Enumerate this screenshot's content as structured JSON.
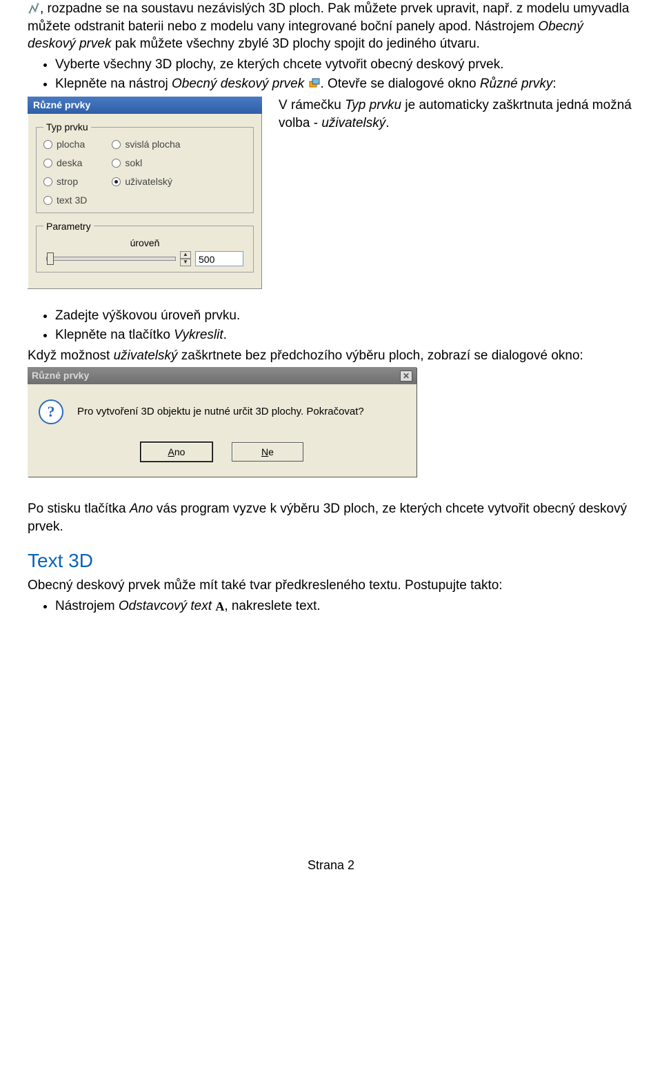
{
  "intro": {
    "p1_prefix": ", rozpadne se na soustavu nezávislých 3D ploch. Pak můžete prvek upravit, např. z modelu umyvadla můžete odstranit baterii nebo z modelu vany integrované boční panely apod. Nástrojem ",
    "p1_italic1": "Obecný deskový prvek",
    "p1_suffix": " pak můžete všechny zbylé 3D plochy spojit do jediného útvaru."
  },
  "bullets1": {
    "b1": "Vyberte všechny 3D plochy, ze kterých chcete vytvořit obecný deskový prvek.",
    "b2_pre": "Klepněte na nástroj ",
    "b2_it": "Obecný deskový prvek",
    "b2_mid": ". Otevře se dialogové okno ",
    "b2_it2": "Různé prvky",
    "b2_end": ":"
  },
  "panel1": {
    "title": "Různé prvky",
    "legend_typ": "Typ prvku",
    "radios": {
      "plocha": "plocha",
      "deska": "deska",
      "strop": "strop",
      "text3d": "text 3D",
      "svisla": "svislá plocha",
      "sokl": "sokl",
      "uzivatelsky": "uživatelský"
    },
    "legend_param": "Parametry",
    "param_label": "úroveň",
    "value": "500"
  },
  "side_note": {
    "pre": "V rámečku ",
    "it1": "Typ prvku",
    "mid": " je automaticky zaškrtnuta jedná možná volba - ",
    "it2": "uživatelský",
    "end": "."
  },
  "bullets2": {
    "b1": "Zadejte výškovou úroveň prvku.",
    "b2_pre": "Klepněte na tlačítko ",
    "b2_it": "Vykreslit",
    "b2_end": "."
  },
  "p_after": {
    "pre": "Když možnost ",
    "it": "uživatelský",
    "post": " zaškrtnete bez předchozího výběru ploch, zobrazí se dialogové okno:"
  },
  "dialog2": {
    "title": "Různé prvky",
    "msg": "Pro vytvoření 3D objektu je nutné určit 3D plochy. Pokračovat?",
    "btn_yes": "Ano",
    "btn_no": "Ne"
  },
  "p_after2": {
    "pre": "Po stisku tlačítka ",
    "it": "Ano",
    "post": " vás program vyzve k výběru 3D ploch, ze kterých chcete vytvořit obecný deskový prvek."
  },
  "heading": "Text 3D",
  "p_text3d": "Obecný deskový prvek může mít také tvar předkresleného textu. Postupujte takto:",
  "bullets3": {
    "pre": "Nástrojem ",
    "it": "Odstavcový text",
    "post": ", nakreslete text."
  },
  "footer": "Strana 2"
}
